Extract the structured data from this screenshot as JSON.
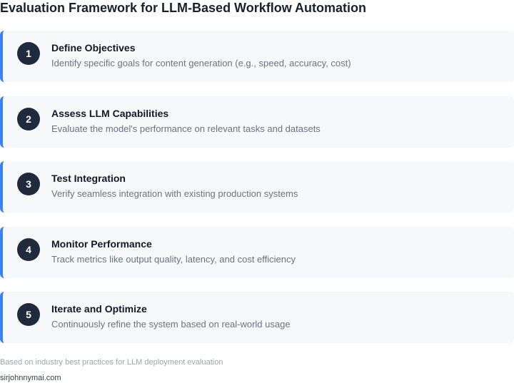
{
  "title": "Evaluation Framework for LLM-Based Workflow Automation",
  "steps": [
    {
      "number": "1",
      "title": "Define Objectives",
      "description": "Identify specific goals for content generation (e.g., speed, accuracy, cost)"
    },
    {
      "number": "2",
      "title": "Assess LLM Capabilities",
      "description": "Evaluate the model's performance on relevant tasks and datasets"
    },
    {
      "number": "3",
      "title": "Test Integration",
      "description": "Verify seamless integration with existing production systems"
    },
    {
      "number": "4",
      "title": "Monitor Performance",
      "description": "Track metrics like output quality, latency, and cost efficiency"
    },
    {
      "number": "5",
      "title": "Iterate and Optimize",
      "description": "Continuously refine the system based on real-world usage"
    }
  ],
  "footnote": "Based on industry best practices for LLM deployment evaluation",
  "credit": "sirjohnnymai.com",
  "colors": {
    "accent_border": "#3b82f6",
    "badge_background": "#1f2a3d",
    "card_background": "#f7f8fa"
  }
}
